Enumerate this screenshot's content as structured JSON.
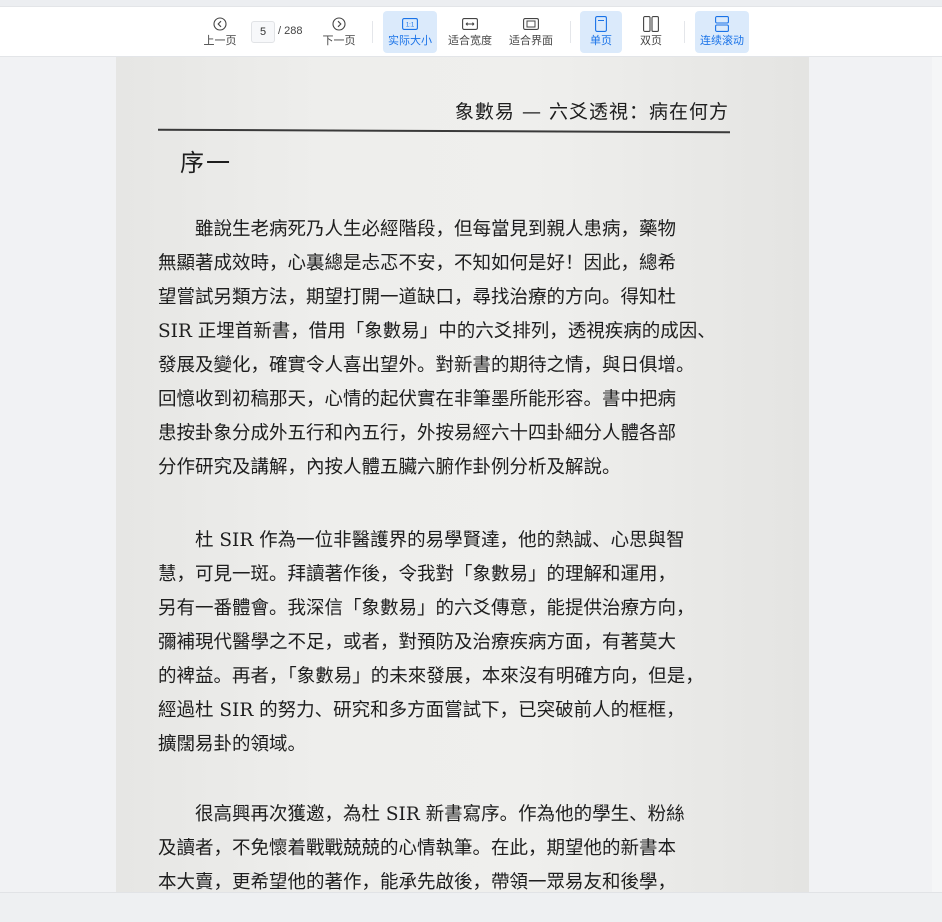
{
  "toolbar": {
    "prev_label": "上一页",
    "next_label": "下一页",
    "current_page": "5",
    "total_pages": "/ 288",
    "actual_size_label": "实际大小",
    "fit_width_label": "适合宽度",
    "fit_page_label": "适合界面",
    "single_page_label": "单页",
    "double_page_label": "双页",
    "continuous_label": "连续滚动",
    "accent_color": "#1a73e8",
    "active_bg": "#dbeafb"
  },
  "document": {
    "header": "象數易 — 六爻透視：病在何方",
    "section_title": "序一",
    "paragraph1": [
      "　　雖說生老病死乃人生必經階段，但每當見到親人患病，藥物",
      "無顯著成效時，心裏總是忐忑不安，不知如何是好！因此，總希",
      "望嘗試另類方法，期望打開一道缺口，尋找治療的方向。得知杜",
      "SIR 正埋首新書，借用「象數易」中的六爻排列，透視疾病的成因、",
      "發展及變化，確實令人喜出望外。對新書的期待之情，與日俱增。",
      "回憶收到初稿那天，心情的起伏實在非筆墨所能形容。書中把病",
      "患按卦象分成外五行和內五行，外按易經六十四卦細分人體各部",
      "分作研究及講解，內按人體五臟六腑作卦例分析及解說。"
    ],
    "paragraph2": [
      "　　杜 SIR 作為一位非醫護界的易學賢達，他的熱誠、心思與智",
      "慧，可見一斑。拜讀著作後，令我對「象數易」的理解和運用，",
      "另有一番體會。我深信「象數易」的六爻傳意，能提供治療方向，",
      "彌補現代醫學之不足，或者，對預防及治療疾病方面，有著莫大",
      "的裨益。再者，「象數易」的未來發展，本來沒有明確方向，但是，",
      "經過杜 SIR 的努力、研究和多方面嘗試下，已突破前人的框框，",
      "擴闊易卦的領域。"
    ],
    "paragraph3": [
      "　　很高興再次獲邀，為杜 SIR 新書寫序。作為他的學生、粉絲",
      "及讀者，不免懷着戰戰兢兢的心情執筆。在此，期望他的新書本",
      "本大賣，更希望他的著作，能承先啟後，帶領一眾易友和後學，"
    ]
  }
}
